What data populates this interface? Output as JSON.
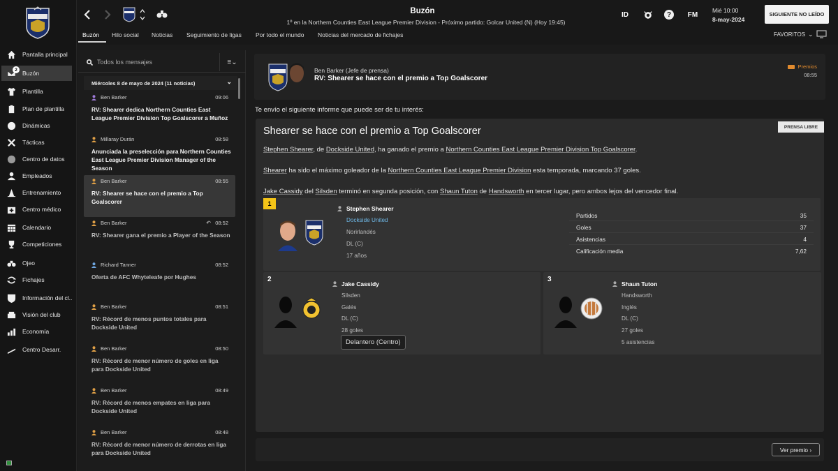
{
  "sidebar": {
    "badge": "2",
    "items": [
      {
        "label": "Pantalla principal",
        "icon": "home-icon"
      },
      {
        "label": "Buzón",
        "icon": "inbox-icon"
      },
      {
        "label": "Plantilla",
        "icon": "shirt-icon"
      },
      {
        "label": "Plan de plantilla",
        "icon": "clipboard-icon"
      },
      {
        "label": "Dinámicas",
        "icon": "dynamics-icon"
      },
      {
        "label": "Tácticas",
        "icon": "tactics-icon"
      },
      {
        "label": "Centro de datos",
        "icon": "data-icon"
      },
      {
        "label": "Empleados",
        "icon": "staff-icon"
      },
      {
        "label": "Entrenamiento",
        "icon": "cone-icon"
      },
      {
        "label": "Centro médico",
        "icon": "medical-icon"
      },
      {
        "label": "Calendario",
        "icon": "calendar-icon"
      },
      {
        "label": "Competiciones",
        "icon": "trophy-icon"
      },
      {
        "label": "Ojeo",
        "icon": "binoculars-icon"
      },
      {
        "label": "Fichajes",
        "icon": "transfer-icon"
      },
      {
        "label": "Información del cl...",
        "icon": "club-info-icon"
      },
      {
        "label": "Visión del club",
        "icon": "vision-icon"
      },
      {
        "label": "Economía",
        "icon": "finance-icon"
      },
      {
        "label": "Centro Desarr.",
        "icon": "development-icon"
      }
    ]
  },
  "topbar": {
    "title": "Buzón",
    "subtitle": "1º en la Northern Counties East League Premier Division - Próximo partido: Golcar United (N) (Hoy 19:45)",
    "tabs": [
      "Buzón",
      "Hilo social",
      "Noticias",
      "Seguimiento de ligas",
      "Por todo el mundo",
      "Noticias del mercado de fichajes"
    ],
    "id_label": "ID",
    "help_label": "?",
    "fm_label": "FM",
    "day_time": "Mié 10:00",
    "date": "8-may-2024",
    "next_button": "SIGUIENTE NO LEÍDO",
    "favorites": "FAVORITOS"
  },
  "inbox": {
    "search_placeholder": "Todos los mensajes",
    "day_header": "Miércoles 8 de mayo de 2024 (11 noticias)",
    "messages": [
      {
        "sender": "Ben Barker",
        "time": "09:06",
        "subject": "RV: Shearer dedica Northern Counties East League Premier Division Top Goalscorer a Muñoz"
      },
      {
        "sender": "Millaray Durán",
        "time": "08:58",
        "subject": "Anunciada la preselección para Northern Counties East League Premier Division Manager of the Season"
      },
      {
        "sender": "Ben Barker",
        "time": "08:55",
        "subject": "RV: Shearer se hace con el premio a Top Goalscorer"
      },
      {
        "sender": "Ben Barker",
        "time": "08:52",
        "subject": "RV: Shearer gana el premio a Player of the Season"
      },
      {
        "sender": "Richard Tanner",
        "time": "08:52",
        "subject": "Oferta de AFC Whyteleafe por Hughes"
      },
      {
        "sender": "Ben Barker",
        "time": "08:51",
        "subject": "RV: Récord de menos puntos totales para Dockside United"
      },
      {
        "sender": "Ben Barker",
        "time": "08:50",
        "subject": "RV: Récord de menor número de goles en liga para Dockside United"
      },
      {
        "sender": "Ben Barker",
        "time": "08:49",
        "subject": "RV: Récord de menos empates en liga para Dockside United"
      },
      {
        "sender": "Ben Barker",
        "time": "08:48",
        "subject": "RV: Récord de menor número de derrotas en liga para Dockside United"
      }
    ]
  },
  "message": {
    "from": "Ben Barker  (Jefe de prensa)",
    "subject": "RV: Shearer se hace con el premio a Top Goalscorer",
    "category": "Premios",
    "time": "08:55",
    "intro": "Te envío el siguiente informe que puede ser de tu interés:",
    "article_title": "Shearer se hace con el premio a Top Goalscorer",
    "press_tag": "PRENSA LIBRE",
    "p1": {
      "a": "Stephen Shearer",
      "b": ", de ",
      "c": "Dockside United",
      "d": ", ha ganado el premio a ",
      "e": "Northern Counties East League Premier Division Top Goalscorer",
      "f": "."
    },
    "p2": {
      "a": "Shearer",
      "b": " ha sido el máximo goleador de la ",
      "c": "Northern Counties East League Premier Division",
      "d": " esta temporada, marcando 37 goles."
    },
    "p3": {
      "a": "Jake Cassidy",
      "b": " del ",
      "c": "Silsden",
      "d": " terminó en segunda posición, con ",
      "e": "Shaun Tuton",
      "f": " de ",
      "g": "Handsworth",
      "h": " en tercer lugar, pero ambos lejos del vencedor final."
    },
    "winner": {
      "rank": "1",
      "name": "Stephen Shearer",
      "club": "Dockside United",
      "nationality": "Norirlandés",
      "position": "DL (C)",
      "age": "17 años",
      "stats": [
        {
          "label": "Partidos",
          "value": "35"
        },
        {
          "label": "Goles",
          "value": "37"
        },
        {
          "label": "Asistencias",
          "value": "4"
        },
        {
          "label": "Calificación media",
          "value": "7,62"
        }
      ]
    },
    "second": {
      "rank": "2",
      "name": "Jake Cassidy",
      "club": "Silsden",
      "nationality": "Galés",
      "position": "DL (C)",
      "goals": "28 goles"
    },
    "third": {
      "rank": "3",
      "name": "Shaun Tuton",
      "club": "Handsworth",
      "nationality": "Inglés",
      "position": "DL (C)",
      "goals": "27 goles",
      "assists": "5 asistencias"
    },
    "tooltip": "Delantero (Centro)",
    "view_button": "Ver premio"
  },
  "colors": {
    "accent_gold": "#f5c518",
    "link_blue": "#6fb9e8",
    "category_orange": "#e08a2e",
    "club_blue": "#1f3a8a"
  }
}
